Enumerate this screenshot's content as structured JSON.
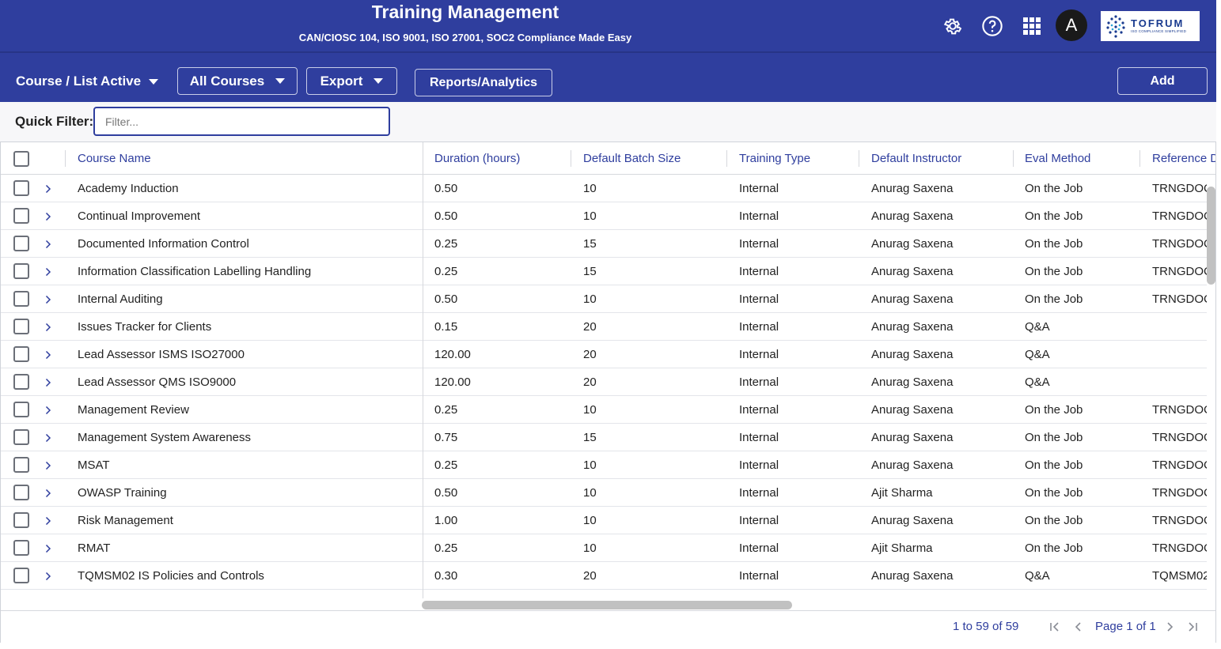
{
  "header": {
    "title": "Training Management",
    "subtitle": "CAN/CIOSC 104, ISO 9001, ISO 27001, SOC2 Compliance Made Easy",
    "avatar_initial": "A",
    "logo_name": "TOFRUM",
    "logo_tagline": "ISO COMPLIANCE SIMPLIFIED",
    "icons": [
      "settings-icon",
      "help-icon",
      "apps-grid-icon"
    ]
  },
  "toolbar": {
    "view_label": "Course / List Active",
    "filter_dropdown_label": "All Courses",
    "export_label": "Export",
    "reports_label": "Reports/Analytics",
    "add_label": "Add"
  },
  "filter": {
    "label": "Quick Filter:",
    "placeholder": "Filter...",
    "value": ""
  },
  "grid": {
    "columns": [
      "Course Name",
      "Duration (hours)",
      "Default Batch Size",
      "Training Type",
      "Default Instructor",
      "Eval Method",
      "Reference D"
    ],
    "rows": [
      [
        "Academy Induction",
        "0.50",
        "10",
        "Internal",
        "Anurag Saxena",
        "On the Job",
        "TRNGDOC"
      ],
      [
        "Continual Improvement",
        "0.50",
        "10",
        "Internal",
        "Anurag Saxena",
        "On the Job",
        "TRNGDOC"
      ],
      [
        "Documented Information Control",
        "0.25",
        "15",
        "Internal",
        "Anurag Saxena",
        "On the Job",
        "TRNGDOC"
      ],
      [
        "Information Classification Labelling Handling",
        "0.25",
        "15",
        "Internal",
        "Anurag Saxena",
        "On the Job",
        "TRNGDOC"
      ],
      [
        "Internal Auditing",
        "0.50",
        "10",
        "Internal",
        "Anurag Saxena",
        "On the Job",
        "TRNGDOC"
      ],
      [
        "Issues Tracker for Clients",
        "0.15",
        "20",
        "Internal",
        "Anurag Saxena",
        "Q&A",
        ""
      ],
      [
        "Lead Assessor ISMS ISO27000",
        "120.00",
        "20",
        "Internal",
        "Anurag Saxena",
        "Q&A",
        ""
      ],
      [
        "Lead Assessor QMS ISO9000",
        "120.00",
        "20",
        "Internal",
        "Anurag Saxena",
        "Q&A",
        ""
      ],
      [
        "Management Review",
        "0.25",
        "10",
        "Internal",
        "Anurag Saxena",
        "On the Job",
        "TRNGDOC"
      ],
      [
        "Management System Awareness",
        "0.75",
        "15",
        "Internal",
        "Anurag Saxena",
        "On the Job",
        "TRNGDOC"
      ],
      [
        "MSAT",
        "0.25",
        "10",
        "Internal",
        "Anurag Saxena",
        "On the Job",
        "TRNGDOC"
      ],
      [
        "OWASP Training",
        "0.50",
        "10",
        "Internal",
        "Ajit Sharma",
        "On the Job",
        "TRNGDOC"
      ],
      [
        "Risk Management",
        "1.00",
        "10",
        "Internal",
        "Anurag Saxena",
        "On the Job",
        "TRNGDOC"
      ],
      [
        "RMAT",
        "0.25",
        "10",
        "Internal",
        "Ajit Sharma",
        "On the Job",
        "TRNGDOC"
      ],
      [
        "TQMSM02 IS Policies and Controls",
        "0.30",
        "20",
        "Internal",
        "Anurag Saxena",
        "Q&A",
        "TQMSM02"
      ]
    ]
  },
  "pagination": {
    "range_text": "1 to 59 of 59",
    "page_text": "Page 1 of 1"
  },
  "colors": {
    "primary": "#2f3e9e",
    "header_text": "#ffffff",
    "link_text": "#2f3e9e"
  }
}
